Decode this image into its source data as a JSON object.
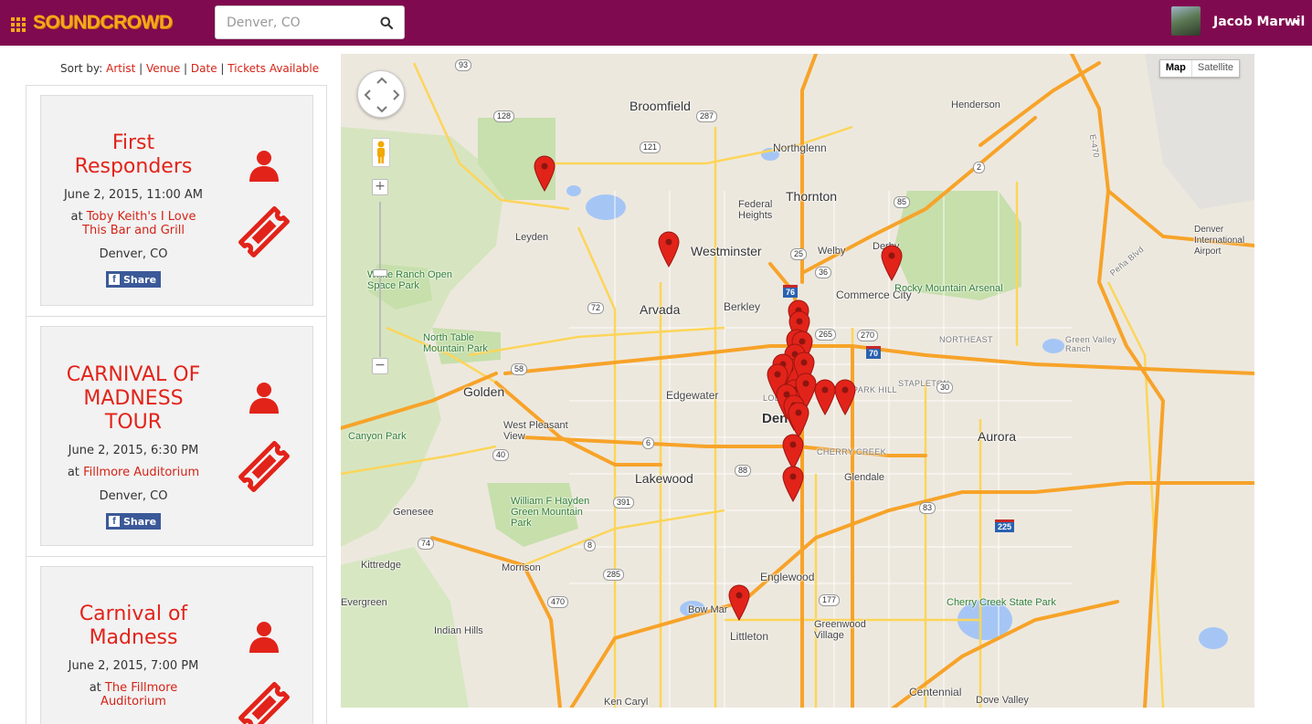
{
  "app": {
    "brand": "SOUNDCROWD",
    "search": {
      "placeholder": "Denver, CO"
    },
    "user": {
      "name": "Jacob Marwil"
    }
  },
  "sort": {
    "prefix": "Sort by:",
    "options": [
      "Artist",
      "Venue",
      "Date",
      "Tickets Available"
    ]
  },
  "events": [
    {
      "title_lines": [
        "First",
        "Responders"
      ],
      "date": "June 2, 2015, 11:00 AM",
      "venue_prefix": "at",
      "venue_lines": [
        "Toby Keith's I Love",
        "This Bar and Grill"
      ],
      "city": "Denver, CO",
      "share_label": "Share"
    },
    {
      "title_lines": [
        "CARNIVAL OF",
        "MADNESS",
        "TOUR"
      ],
      "date": "June 2, 2015, 6:30 PM",
      "venue_prefix": "at",
      "venue_lines": [
        "Fillmore Auditorium"
      ],
      "city": "Denver, CO",
      "share_label": "Share"
    },
    {
      "title_lines": [
        "Carnival of",
        "Madness"
      ],
      "date": "June 2, 2015, 7:00 PM",
      "venue_prefix": "at",
      "venue_lines": [
        "The Fillmore",
        "Auditorium"
      ],
      "city": "",
      "share_label": ""
    }
  ],
  "map": {
    "type_buttons": {
      "map": "Map",
      "satellite": "Satellite",
      "selected": "Map"
    },
    "zoom": {
      "in": "+",
      "out": "−"
    },
    "cities": [
      "Broomfield",
      "Northglenn",
      "Thornton",
      "Westminster",
      "Arvada",
      "Berkley",
      "Golden",
      "Edgewater",
      "Lakewood",
      "Denver",
      "Aurora",
      "Englewood",
      "Littleton",
      "Centennial",
      "Henderson",
      "Commerce City",
      "Federal Heights",
      "Welby",
      "Derby",
      "Leyden",
      "West Pleasant View",
      "Morrison",
      "Kittredge",
      "Evergreen",
      "Genesee",
      "Indian Hills",
      "Glendale",
      "Bow Mar",
      "Greenwood Village",
      "Ken Caryl",
      "Dove Valley",
      "Denver International Airport"
    ],
    "parks": [
      "White Ranch Open Space Park",
      "North Table Mountain Park",
      "Rocky Mountain Arsenal",
      "William F Hayden Green Mountain Park",
      "Cherry Creek State Park",
      "Canyon Park",
      "Green Valley Ranch"
    ],
    "districts": [
      "NORTHEAST",
      "STAPLETON",
      "PARK HILL",
      "CHERRY CREEK",
      "LODO"
    ],
    "roads": [
      "93",
      "128",
      "287",
      "121",
      "72",
      "76",
      "36",
      "85",
      "2",
      "265",
      "270",
      "25",
      "70",
      "225",
      "6",
      "58",
      "40",
      "391",
      "8",
      "285",
      "470",
      "88",
      "177",
      "83",
      "E-470",
      "Peña Blvd",
      "30",
      "74"
    ],
    "marker_count": 22
  },
  "colors": {
    "brand_bar": "#800a4f",
    "logo": "#f7a81b",
    "accent_red": "#e2231a",
    "marker": "#e2231a",
    "facebook": "#3b5998"
  }
}
